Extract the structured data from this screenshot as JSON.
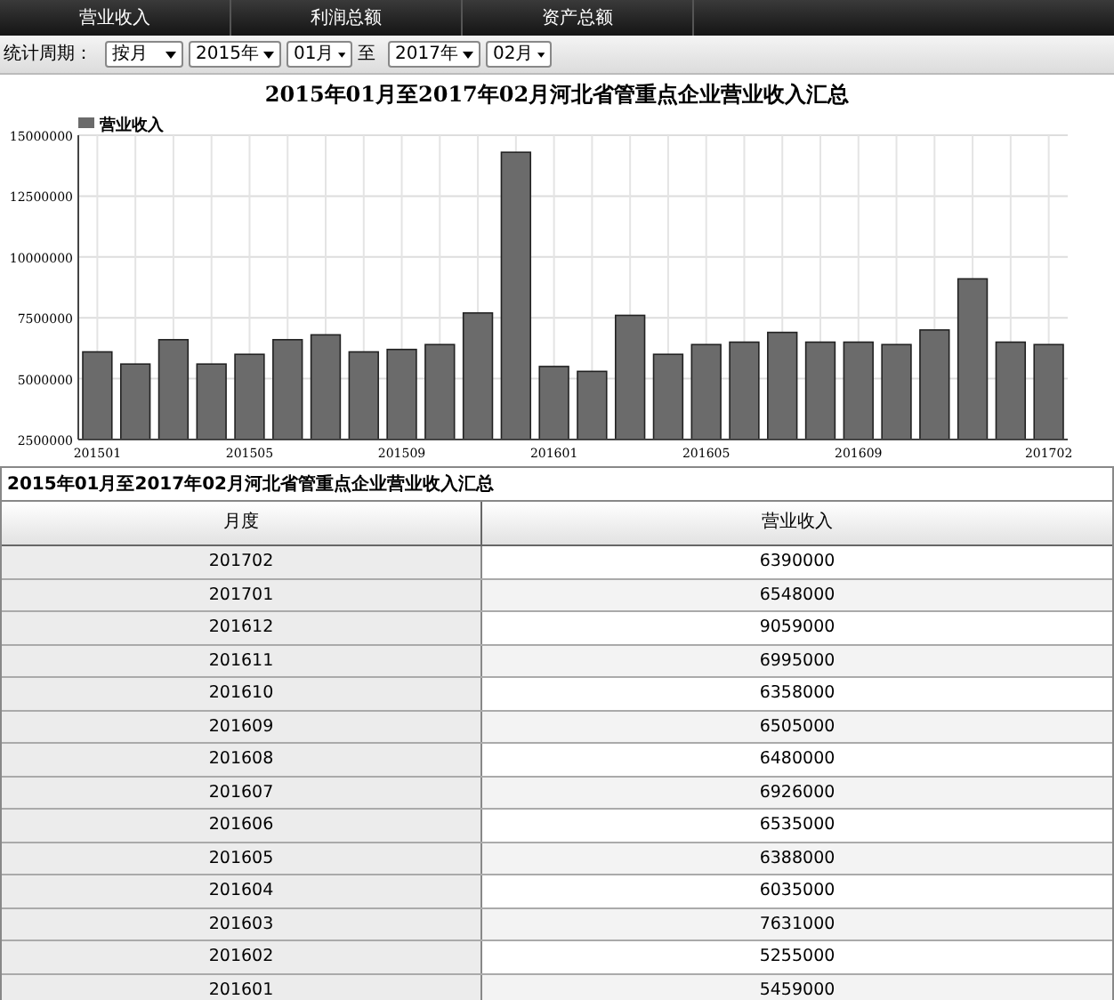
{
  "nav_tabs": [
    {
      "label": "营业收入"
    },
    {
      "label": "利润总额"
    },
    {
      "label": "资产总额"
    }
  ],
  "filter": {
    "label": "统计周期：",
    "period": "按月",
    "start_year": "2015年",
    "start_month": "01月",
    "separator": "至",
    "end_year": "2017年",
    "end_month": "02月"
  },
  "chart": {
    "title": "2015年01月至2017年02月河北省管重点企业营业收入汇总",
    "chart_data": {
      "type": "bar",
      "grid": true,
      "categories": [
        "201501",
        null,
        null,
        null,
        "201505",
        null,
        null,
        null,
        "201509",
        null,
        null,
        null,
        "201601",
        null,
        null,
        null,
        "201605",
        null,
        null,
        null,
        "201609",
        null,
        null,
        null,
        null,
        "201702"
      ],
      "series": [
        {
          "name": "营业收入",
          "color": "#6b6b6b",
          "values": [
            6100000,
            5600000,
            6600000,
            5600000,
            6000000,
            6600000,
            6800000,
            6100000,
            6200000,
            6400000,
            7700000,
            14300000,
            5500000,
            5300000,
            7600000,
            6000000,
            6400000,
            6500000,
            6900000,
            6500000,
            6500000,
            6400000,
            7000000,
            9100000,
            6500000,
            6400000
          ]
        }
      ],
      "ylim": [
        2500000,
        15000000
      ],
      "yticks": [
        2500000,
        5000000,
        7500000,
        10000000,
        12500000,
        15000000
      ]
    }
  },
  "table": {
    "title": "2015年01月至2017年02月河北省管重点企业营业收入汇总",
    "columns": [
      "月度",
      "营业收入"
    ],
    "rows": [
      [
        "201702",
        "6390000"
      ],
      [
        "201701",
        "6548000"
      ],
      [
        "201612",
        "9059000"
      ],
      [
        "201611",
        "6995000"
      ],
      [
        "201610",
        "6358000"
      ],
      [
        "201609",
        "6505000"
      ],
      [
        "201608",
        "6480000"
      ],
      [
        "201607",
        "6926000"
      ],
      [
        "201606",
        "6535000"
      ],
      [
        "201605",
        "6388000"
      ],
      [
        "201604",
        "6035000"
      ],
      [
        "201603",
        "7631000"
      ],
      [
        "201602",
        "5255000"
      ],
      [
        "201601",
        "5459000"
      ]
    ]
  }
}
